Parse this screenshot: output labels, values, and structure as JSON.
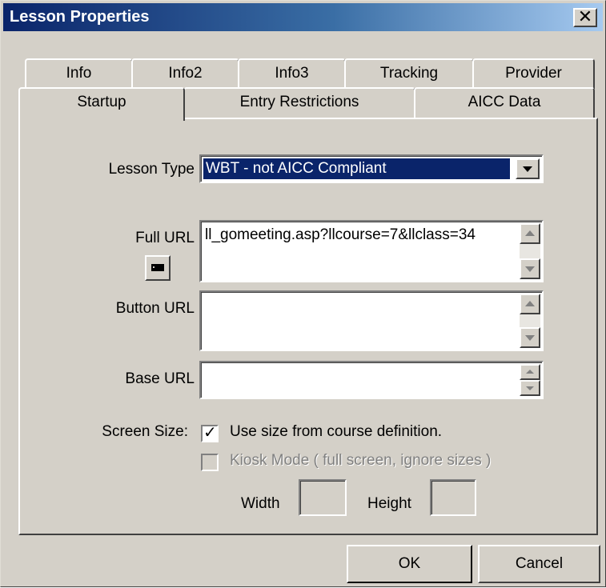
{
  "window": {
    "title": "Lesson Properties",
    "close_label": "✕"
  },
  "tabs_back": [
    {
      "label": "Info"
    },
    {
      "label": "Info2"
    },
    {
      "label": "Info3"
    },
    {
      "label": "Tracking"
    },
    {
      "label": "Provider"
    }
  ],
  "tabs_front": [
    {
      "label": "Startup",
      "active": true
    },
    {
      "label": "Entry Restrictions"
    },
    {
      "label": "AICC Data"
    }
  ],
  "form": {
    "lesson_type": {
      "label": "Lesson Type",
      "value": "WBT - not AICC Compliant"
    },
    "full_url": {
      "label": "Full URL",
      "value": "ll_gomeeting.asp?llcourse=7&llclass=34"
    },
    "button_url": {
      "label": "Button URL",
      "value": ""
    },
    "base_url": {
      "label": "Base URL",
      "value": ""
    },
    "screen_size": {
      "label": "Screen Size:",
      "use_course_size": {
        "label": "Use size from course definition.",
        "checked": true
      },
      "kiosk_mode": {
        "label": "Kiosk Mode ( full screen, ignore sizes )",
        "checked": false,
        "disabled": true
      },
      "width_label": "Width",
      "width_value": "",
      "height_label": "Height",
      "height_value": ""
    }
  },
  "buttons": {
    "ok": "OK",
    "cancel": "Cancel"
  }
}
